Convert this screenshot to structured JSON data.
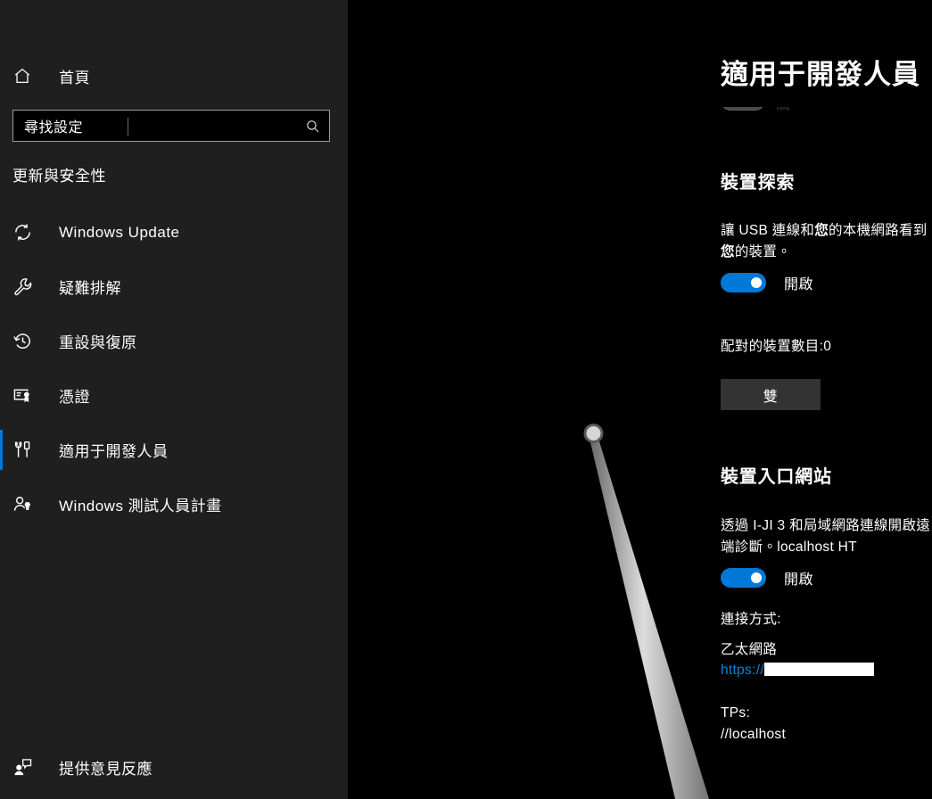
{
  "sidebar": {
    "home": {
      "label": "首頁",
      "icon": "home-icon"
    },
    "search": {
      "value": "尋找設定",
      "placeholder": "尋找設定",
      "icon": "search-icon"
    },
    "category": "更新與安全性",
    "items": [
      {
        "label": "Windows Update",
        "icon": "sync-icon",
        "selected": false
      },
      {
        "label": "疑難排解",
        "icon": "wrench-icon",
        "selected": false
      },
      {
        "label": "重設與復原",
        "icon": "history-clock-icon",
        "selected": false
      },
      {
        "label": "憑證",
        "icon": "certificate-icon",
        "selected": false
      },
      {
        "label": "適用于開發人員",
        "icon": "tools-icon",
        "selected": true
      },
      {
        "label": "Windows 測試人員計畫",
        "icon": "insider-person-icon",
        "selected": false
      }
    ],
    "feedback": {
      "label": "提供意見反應",
      "icon": "feedback-person-icon"
    },
    "accent_color": "#0078d7",
    "background_color": "#1f1f1f"
  },
  "main": {
    "title": "適用于開發人員",
    "background_color": "#000000",
    "clipped_toggle": {
      "state_label": "關"
    },
    "device_discovery": {
      "heading": "裝置探索",
      "description_prefix": "讓 USB 連線和",
      "description_bold1": "您",
      "description_mid": "的本機網路看到",
      "description_bold2": "您",
      "description_suffix": "的裝置。",
      "toggle": {
        "label": "開啟",
        "on": true,
        "color": "#0078d7"
      },
      "paired_count_line": "配對的裝置數目:0",
      "pair_button": "雙"
    },
    "device_portal": {
      "heading": "裝置入口網站",
      "description": "透過 I-JI 3 和局域網路連線開啟遠端診斷。localhost HT",
      "toggle": {
        "label": "開啟",
        "on": true,
        "color": "#0078d7"
      },
      "connect_label": "連接方式:",
      "connection_type": "乙太網路",
      "link_text": "https://",
      "link_redacted": true,
      "tps_label": "TPs:",
      "tps_value": "//localhost"
    }
  }
}
